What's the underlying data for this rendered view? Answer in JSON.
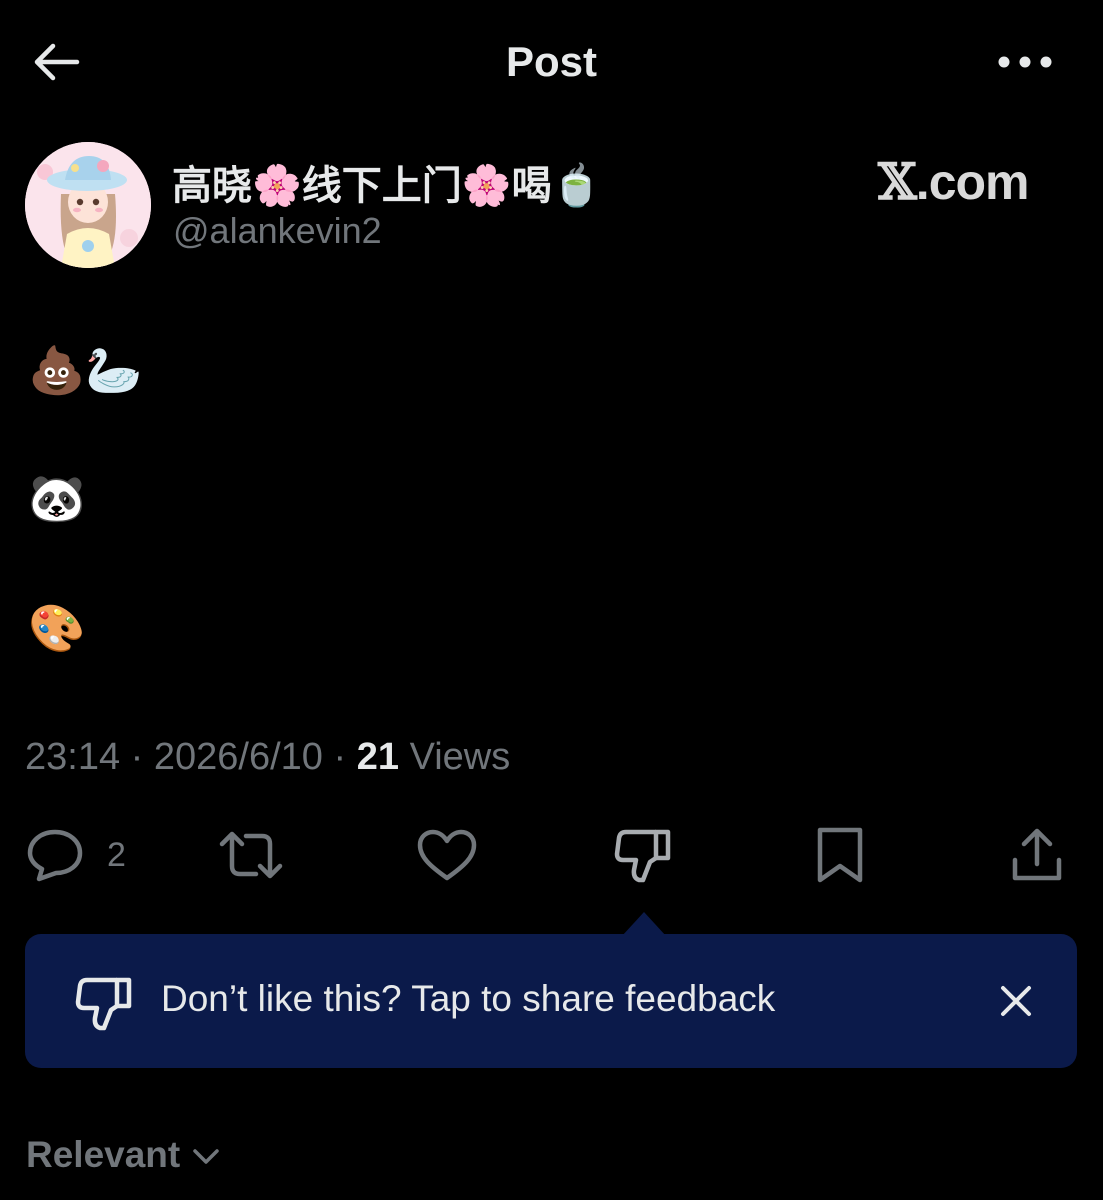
{
  "header": {
    "title": "Post"
  },
  "author": {
    "name": "高晓🌸线下上门🌸喝🍵",
    "handle": "@alankevin2"
  },
  "watermark": {
    "x": "𝕏",
    "domain": ".com"
  },
  "post": {
    "lines": [
      "💩🦢",
      "🐼",
      "🎨"
    ]
  },
  "meta": {
    "time": "23:14",
    "separator": "·",
    "date": "2026/6/10",
    "views_count": "21",
    "views_label": "Views"
  },
  "actions": {
    "reply_count": "2",
    "icons": [
      "reply-icon",
      "repost-icon",
      "like-icon",
      "dislike-icon",
      "bookmark-icon",
      "share-icon"
    ]
  },
  "tooltip": {
    "text": "Don’t like this? Tap to share feedback"
  },
  "sort": {
    "label": "Relevant"
  },
  "colors": {
    "background": "#000000",
    "text": "#e7e9ea",
    "muted": "#71767b",
    "tooltip_bg": "#0b1a4a",
    "icon": "#71767b"
  }
}
